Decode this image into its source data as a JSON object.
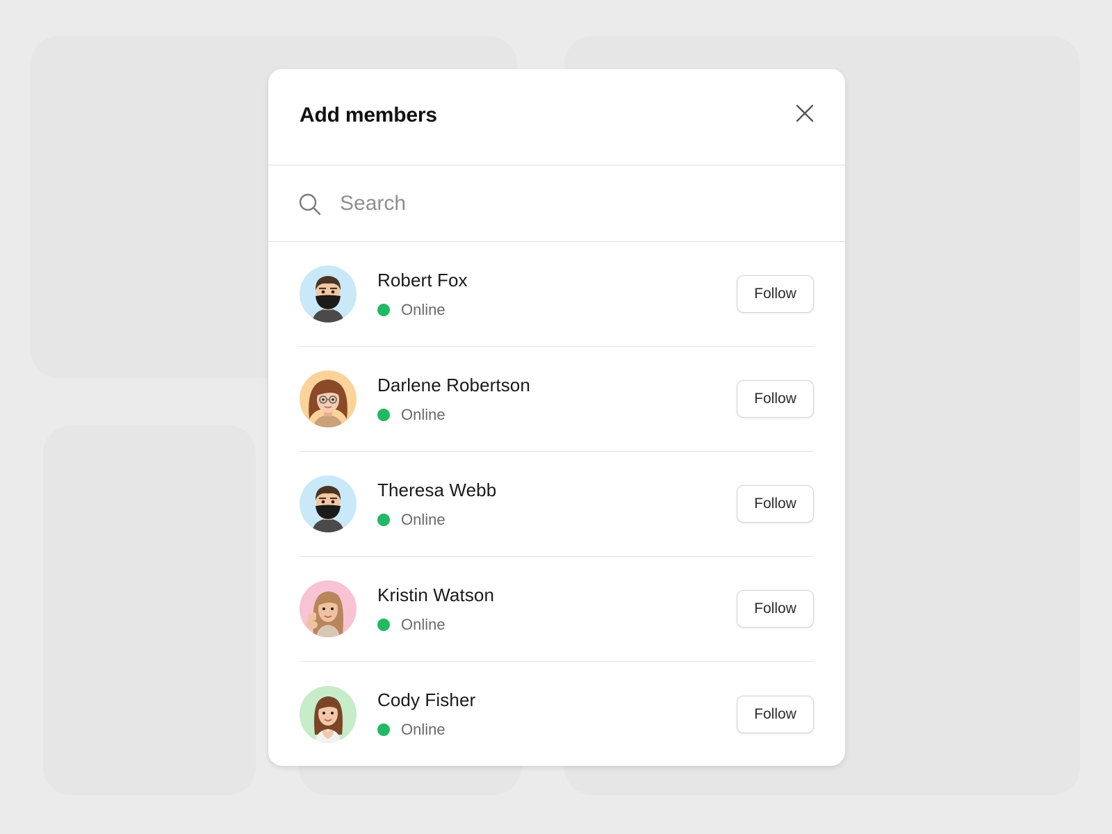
{
  "modal": {
    "title": "Add members",
    "close_icon": "close-icon"
  },
  "search": {
    "placeholder": "Search",
    "value": "",
    "icon": "search-icon"
  },
  "colors": {
    "status_online": "#22b864",
    "avatar_blue": "#c9e8f8",
    "avatar_orange": "#fbd29a",
    "avatar_pink": "#f8c3d3",
    "avatar_green": "#c6ecc9"
  },
  "members": [
    {
      "name": "Robert Fox",
      "status": "Online",
      "action": "Follow",
      "avatar_icon": "memoji-man-mask-icon"
    },
    {
      "name": "Darlene Robertson",
      "status": "Online",
      "action": "Follow",
      "avatar_icon": "memoji-woman-glasses-icon"
    },
    {
      "name": "Theresa Webb",
      "status": "Online",
      "action": "Follow",
      "avatar_icon": "memoji-man-mask-icon"
    },
    {
      "name": "Kristin Watson",
      "status": "Online",
      "action": "Follow",
      "avatar_icon": "memoji-woman-peace-icon"
    },
    {
      "name": "Cody Fisher",
      "status": "Online",
      "action": "Follow",
      "avatar_icon": "memoji-woman-heart-icon"
    }
  ]
}
